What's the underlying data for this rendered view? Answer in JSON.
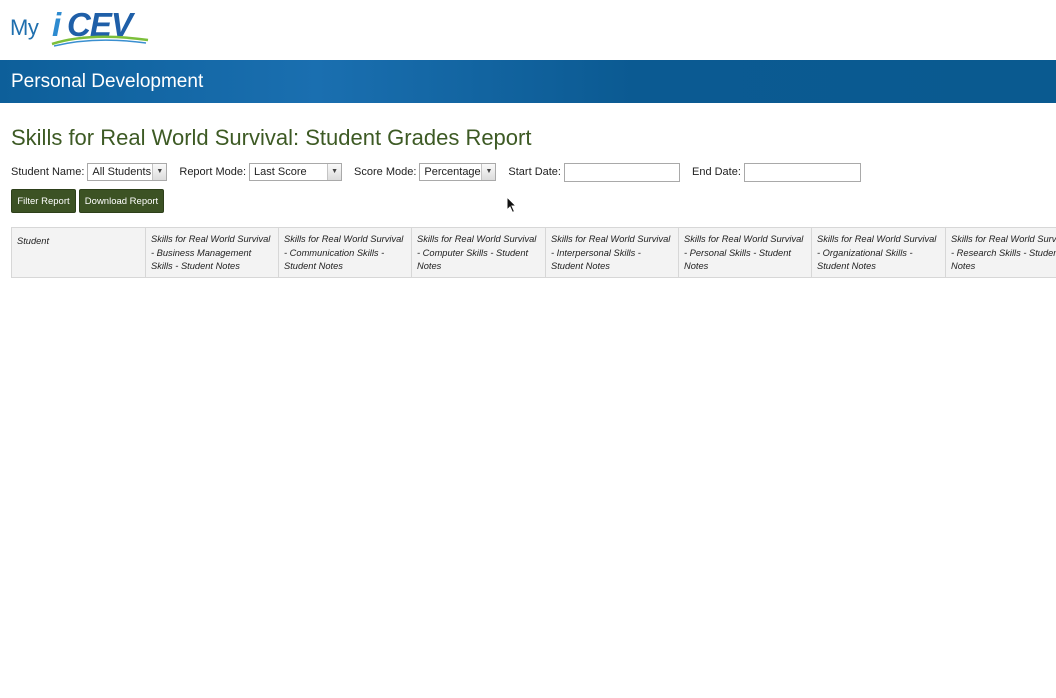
{
  "logo": {
    "my": "My",
    "i": "i",
    "cev": "CEV"
  },
  "banner": {
    "title": "Personal Development"
  },
  "page": {
    "title": "Skills for Real World Survival: Student Grades Report"
  },
  "filters": {
    "student_name_label": "Student Name:",
    "student_name_value": "All Students",
    "report_mode_label": "Report Mode:",
    "report_mode_value": "Last Score",
    "score_mode_label": "Score Mode:",
    "score_mode_value": "Percentage",
    "start_date_label": "Start Date:",
    "start_date_value": "",
    "end_date_label": "End Date:",
    "end_date_value": ""
  },
  "buttons": {
    "filter": "Filter Report",
    "download": "Download Report"
  },
  "table": {
    "columns": [
      "Student",
      "Skills for Real World Survival - Business Management Skills - Student Notes",
      "Skills for Real World Survival - Communication Skills - Student Notes",
      "Skills for Real World Survival - Computer Skills - Student Notes",
      "Skills for Real World Survival - Interpersonal Skills - Student Notes",
      "Skills for Real World Survival - Personal Skills - Student Notes",
      "Skills for Real World Survival - Organizational Skills - Student Notes",
      "Skills for Real World Survival - Research Skills - Student Notes"
    ]
  },
  "colors": {
    "banner": "#0d5f9a",
    "title": "#3d5a24",
    "button": "#3c5224"
  }
}
